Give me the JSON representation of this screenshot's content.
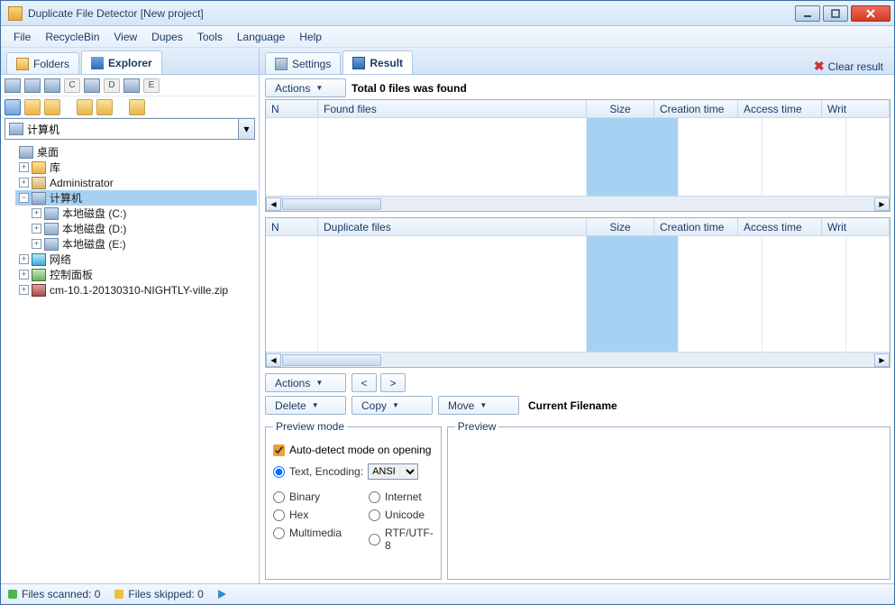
{
  "title": "Duplicate File Detector [New project]",
  "menu": {
    "file": "File",
    "recyclebin": "RecycleBin",
    "view": "View",
    "dupes": "Dupes",
    "tools": "Tools",
    "language": "Language",
    "help": "Help"
  },
  "leftTabs": {
    "folders": "Folders",
    "explorer": "Explorer"
  },
  "drives": {
    "c": "C",
    "d": "D",
    "e": "E"
  },
  "pathCombo": "计算机",
  "tree": {
    "desktop": "桌面",
    "library": "库",
    "admin": "Administrator",
    "computer": "计算机",
    "driveC": "本地磁盘 (C:)",
    "driveD": "本地磁盘 (D:)",
    "driveE": "本地磁盘 (E:)",
    "network": "网络",
    "controlPanel": "控制面板",
    "zip": "cm-10.1-20130310-NIGHTLY-ville.zip"
  },
  "rightTabs": {
    "settings": "Settings",
    "result": "Result",
    "clear": "Clear result"
  },
  "actions": {
    "label": "Actions",
    "totalFound": "Total 0 files was found"
  },
  "grid1": {
    "colN": "N",
    "colFound": "Found files",
    "colSize": "Size",
    "colCreation": "Creation time",
    "colAccess": "Access time",
    "colWrite": "Writ"
  },
  "grid2": {
    "colN": "N",
    "colDup": "Duplicate files",
    "colSize": "Size",
    "colCreation": "Creation time",
    "colAccess": "Access time",
    "colWrite": "Writ"
  },
  "bottom": {
    "actions": "Actions",
    "prev": "<",
    "next": ">",
    "delete": "Delete",
    "copy": "Copy",
    "move": "Move",
    "curfile": "Current Filename"
  },
  "preview": {
    "mode": "Preview mode",
    "auto": "Auto-detect mode on opening",
    "textEnc": "Text, Encoding:",
    "encoding": "ANSI",
    "binary": "Binary",
    "hex": "Hex",
    "multimedia": "Multimedia",
    "internet": "Internet",
    "unicode": "Unicode",
    "rtf": "RTF/UTF-8",
    "previewLabel": "Preview"
  },
  "status": {
    "scanned": "Files scanned: 0",
    "skipped": "Files skipped: 0"
  }
}
